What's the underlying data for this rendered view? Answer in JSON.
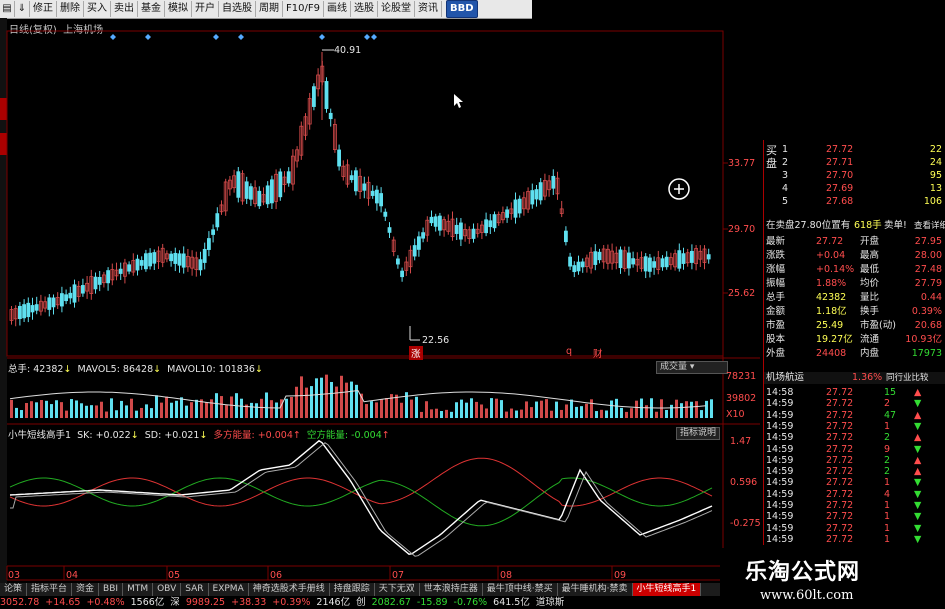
{
  "toolbar": {
    "items": [
      "修正",
      "删除",
      "买入",
      "卖出",
      "基金",
      "模拟",
      "开户",
      "自选股",
      "周期",
      "F10/F9",
      "画线",
      "选股",
      "论股堂",
      "资讯"
    ],
    "bbd": "BBD"
  },
  "chart": {
    "title_prefix": "日线(复权)",
    "title_stock": "上海机场",
    "price_axis": [
      "33.77",
      "29.70",
      "25.62"
    ],
    "high_label": "40.91",
    "low_label": "22.56",
    "markers": [
      "涨",
      "q",
      "财"
    ],
    "x_axis": [
      "03",
      "04",
      "05",
      "06",
      "07",
      "08",
      "09"
    ]
  },
  "volume": {
    "total_label": "总手: 42382",
    "mavol5": "MAVOL5: 86428",
    "mavol10": "MAVOL10: 101836",
    "button": "成交量",
    "axis": [
      "78231",
      "39802",
      "X10"
    ]
  },
  "indicator": {
    "name": "小牛短线高手1",
    "sk": "SK: +0.022",
    "sd": "SD: +0.021",
    "long": "多方能量: +0.004",
    "short": "空方能量: -0.004",
    "button": "指标说明",
    "axis": [
      "1.47",
      "0.596",
      "-0.275"
    ]
  },
  "quote": {
    "buy_label": "买盘",
    "buy_rows": [
      {
        "n": "1",
        "p": "27.72",
        "v": "22"
      },
      {
        "n": "2",
        "p": "27.71",
        "v": "24"
      },
      {
        "n": "3",
        "p": "27.70",
        "v": "95"
      },
      {
        "n": "4",
        "p": "27.69",
        "v": "13"
      },
      {
        "n": "5",
        "p": "27.68",
        "v": "106"
      }
    ],
    "order_line": {
      "text": "在卖盘27.80位置有",
      "qty": "618手",
      "action": "卖单!",
      "link": "查看详细"
    },
    "stats": [
      {
        "k1": "最新",
        "v1": "27.72",
        "k2": "开盘",
        "v2": "27.95"
      },
      {
        "k1": "涨跌",
        "v1": "+0.04",
        "k2": "最高",
        "v2": "28.00"
      },
      {
        "k1": "涨幅",
        "v1": "+0.14%",
        "k2": "最低",
        "v2": "27.48"
      },
      {
        "k1": "振幅",
        "v1": "1.88%",
        "k2": "均价",
        "v2": "27.79"
      },
      {
        "k1": "总手",
        "v1": "42382",
        "k2": "量比",
        "v2": "0.44"
      },
      {
        "k1": "金额",
        "v1": "1.18亿",
        "k2": "换手",
        "v2": "0.39%"
      },
      {
        "k1": "市盈",
        "v1": "25.49",
        "k2": "市盈(动)",
        "v2": "20.68"
      },
      {
        "k1": "股本",
        "v1": "19.27亿",
        "k2": "流通",
        "v2": "10.93亿"
      },
      {
        "k1": "外盘",
        "v1": "24408",
        "k2": "内盘",
        "v2": "17973"
      }
    ],
    "sector_label": "机场航运",
    "sector_pct": "1.36%",
    "sector_btn": "同行业比较",
    "ticks": [
      {
        "t": "14:58",
        "p": "27.72",
        "v": "15",
        "d": "up"
      },
      {
        "t": "14:59",
        "p": "27.72",
        "v": "2",
        "d": "down"
      },
      {
        "t": "14:59",
        "p": "27.72",
        "v": "47",
        "d": "up"
      },
      {
        "t": "14:59",
        "p": "27.72",
        "v": "1",
        "d": "down"
      },
      {
        "t": "14:59",
        "p": "27.72",
        "v": "2",
        "d": "up"
      },
      {
        "t": "14:59",
        "p": "27.72",
        "v": "9",
        "d": "down"
      },
      {
        "t": "14:59",
        "p": "27.72",
        "v": "2",
        "d": "up"
      },
      {
        "t": "14:59",
        "p": "27.72",
        "v": "2",
        "d": "up"
      },
      {
        "t": "14:59",
        "p": "27.72",
        "v": "1",
        "d": "down"
      },
      {
        "t": "14:59",
        "p": "27.72",
        "v": "4",
        "d": "down"
      },
      {
        "t": "14:59",
        "p": "27.72",
        "v": "1",
        "d": "down"
      },
      {
        "t": "14:59",
        "p": "27.72",
        "v": "1",
        "d": "down"
      },
      {
        "t": "14:59",
        "p": "27.72",
        "v": "1",
        "d": "down"
      },
      {
        "t": "14:59",
        "p": "27.72",
        "v": "1",
        "d": "down"
      }
    ]
  },
  "tabs": [
    "论策",
    "指标平台",
    "资金",
    "BBI",
    "MTM",
    "OBV",
    "SAR",
    "EXPMA",
    "神奇选股术手册线",
    "持盘跟踪",
    "天下无双",
    "世本浪持庄器",
    "最牛顶中线·禁买",
    "最牛睡机构·禁卖",
    "小牛短线高手1"
  ],
  "status": [
    {
      "text": "3052.78",
      "c": "red"
    },
    {
      "text": "+14.65",
      "c": "red"
    },
    {
      "text": "+0.48%",
      "c": "red"
    },
    {
      "text": "1566亿",
      "c": "wht"
    },
    {
      "text": "深",
      "c": "wht"
    },
    {
      "text": "9989.25",
      "c": "red"
    },
    {
      "text": "+38.33",
      "c": "red"
    },
    {
      "text": "+0.39%",
      "c": "red"
    },
    {
      "text": "2146亿",
      "c": "wht"
    },
    {
      "text": "创",
      "c": "wht"
    },
    {
      "text": "2082.67",
      "c": "grn"
    },
    {
      "text": "-15.89",
      "c": "grn"
    },
    {
      "text": "-0.76%",
      "c": "grn"
    },
    {
      "text": "641.5亿",
      "c": "wht"
    },
    {
      "text": "道琼斯",
      "c": "wht"
    }
  ],
  "brand": {
    "cn": "乐淘公式网",
    "url": "www.60lt.com"
  },
  "colors": {
    "up": "#d24a4a",
    "down": "#5fe0f0",
    "grid": "#7a0000"
  }
}
